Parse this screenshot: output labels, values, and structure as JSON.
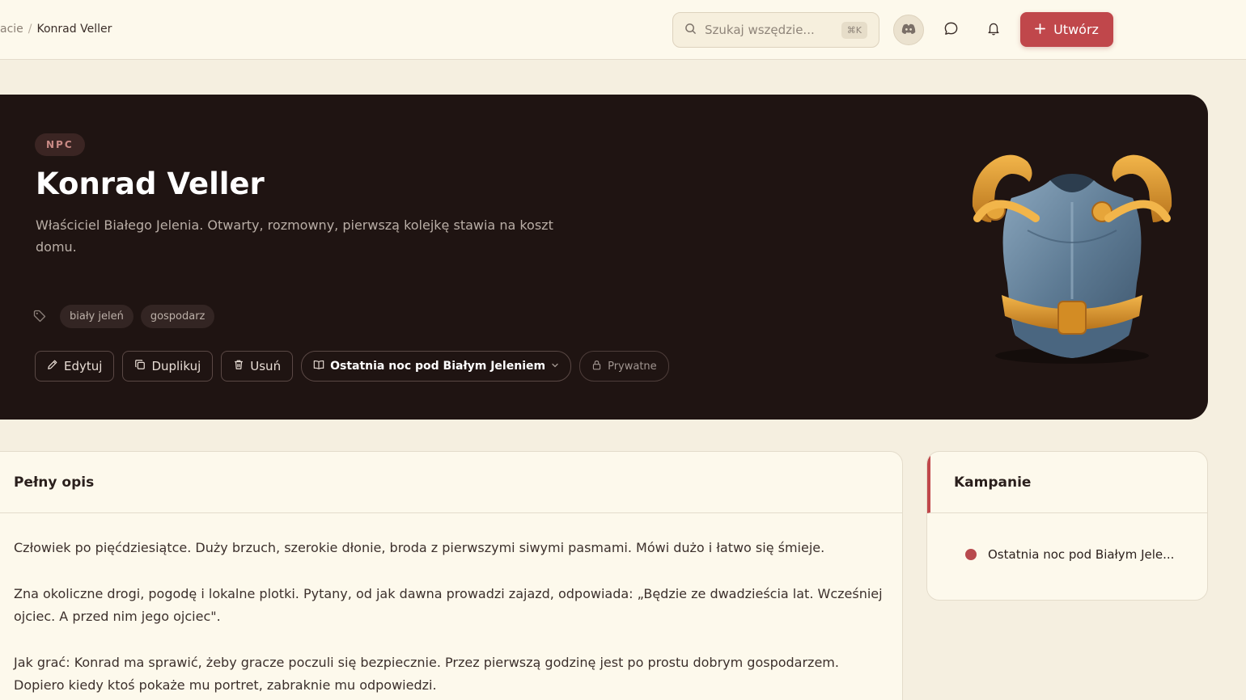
{
  "topbar": {
    "breadcrumb": {
      "prev": "acie",
      "separator": "/",
      "current": "Konrad Veller"
    },
    "search": {
      "placeholder": "Szukaj wszędzie...",
      "shortcut": "⌘K"
    },
    "icons": {
      "discord": "discord-icon",
      "chat": "chat-icon",
      "bell": "bell-icon"
    },
    "create_label": "Utwórz"
  },
  "hero": {
    "badge": "NPC",
    "title": "Konrad Veller",
    "subtitle": "Właściciel Białego Jelenia. Otwarty, rozmowny, pierwszą kolejkę stawia na koszt domu.",
    "tags": [
      "biały jeleń",
      "gospodarz"
    ],
    "actions": {
      "edit": "Edytuj",
      "duplicate": "Duplikuj",
      "delete": "Usuń",
      "campaign": "Ostatnia noc pod Białym Jeleniem",
      "visibility": "Prywatne"
    },
    "image": "armor-breastplate-illustration"
  },
  "description": {
    "heading": "Pełny opis",
    "paragraphs": [
      "Człowiek po pięćdziesiątce. Duży brzuch, szerokie dłonie, broda z pierwszymi siwymi pasmami. Mówi dużo i łatwo się śmieje.",
      "Zna okoliczne drogi, pogodę i lokalne plotki. Pytany, od jak dawna prowadzi zajazd, odpowiada: „Będzie ze dwadzieścia lat. Wcześniej ojciec. A przed nim jego ojciec\".",
      "Jak grać: Konrad ma sprawić, żeby gracze poczuli się bezpiecznie. Przez pierwszą godzinę jest po prostu dobrym gospodarzem. Dopiero kiedy ktoś pokaże mu portret, zabraknie mu odpowiedzi."
    ]
  },
  "campaigns": {
    "heading": "Kampanie",
    "items": [
      "Ostatnia noc pod Białym Jele..."
    ]
  },
  "colors": {
    "accent": "#c0474b",
    "hero_bg": "#1f1412",
    "page_bg": "#f5efe0"
  }
}
